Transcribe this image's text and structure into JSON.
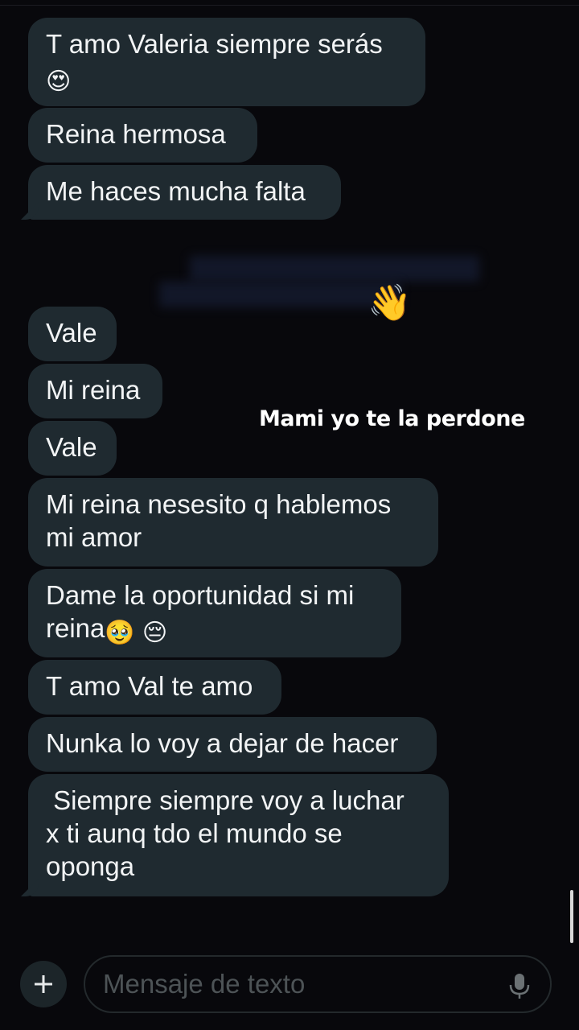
{
  "messages": [
    {
      "line1": "T amo Valeria siempre serás",
      "emoji": "😍"
    },
    {
      "text": "Reina hermosa"
    },
    {
      "text": "Me haces mucha falta"
    },
    {
      "text": "Vale"
    },
    {
      "text": "Mi reina"
    },
    {
      "text": "Vale"
    },
    {
      "line1": "Mi reina nesesito q hablemos",
      "line2": "mi amor"
    },
    {
      "line1": "Dame la oportunidad si mi",
      "line2": "reina",
      "emoji1": "🥹",
      "emoji2": "😔"
    },
    {
      "text": "T amo Val te amo"
    },
    {
      "text": "Nunka lo voy a dejar de hacer"
    },
    {
      "line1": " Siempre siempre voy a luchar",
      "line2": "x ti aunq tdo el mundo se",
      "line3": "oponga"
    }
  ],
  "reaction_emoji": "👋",
  "overlay_caption": "Mami yo te la perdone",
  "composer": {
    "placeholder": "Mensaje de texto",
    "add_icon": "plus-icon",
    "mic_icon": "microphone-icon"
  },
  "colors": {
    "background": "#08080c",
    "bubble": "#1f2a30",
    "text": "#f2f4f5",
    "placeholder": "#4d5356"
  }
}
